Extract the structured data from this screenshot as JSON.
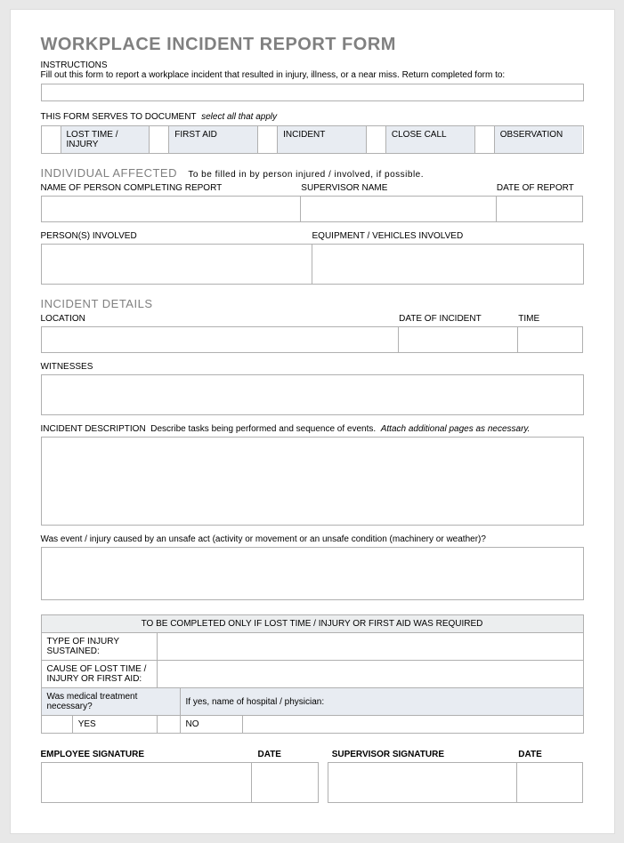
{
  "title": "WORKPLACE INCIDENT REPORT FORM",
  "instructions": {
    "heading": "INSTRUCTIONS",
    "text": "Fill out this form to report a workplace incident that resulted in injury, illness, or a near miss. Return completed form to:"
  },
  "document_purpose": {
    "label": "THIS FORM SERVES TO DOCUMENT",
    "hint": "select all that apply",
    "options": [
      "LOST TIME / INJURY",
      "FIRST AID",
      "INCIDENT",
      "CLOSE CALL",
      "OBSERVATION"
    ]
  },
  "individual": {
    "heading": "INDIVIDUAL AFFECTED",
    "sub": "To be filled in by person injured / involved, if possible.",
    "name_label": "NAME OF PERSON COMPLETING REPORT",
    "supervisor_label": "SUPERVISOR NAME",
    "date_label": "DATE OF REPORT",
    "persons_label": "PERSON(S) INVOLVED",
    "equipment_label": "EQUIPMENT / VEHICLES INVOLVED"
  },
  "details": {
    "heading": "INCIDENT DETAILS",
    "location_label": "LOCATION",
    "date_label": "DATE OF INCIDENT",
    "time_label": "TIME",
    "witnesses_label": "WITNESSES",
    "description_label": "INCIDENT DESCRIPTION",
    "description_hint": "Describe tasks being performed and sequence of events.",
    "description_attach": "Attach additional pages as necessary.",
    "cause_question": "Was event / injury caused by an unsafe act (activity or movement or an unsafe condition (machinery or weather)?"
  },
  "injury": {
    "banner": "TO BE COMPLETED ONLY IF LOST TIME / INJURY OR FIRST AID WAS REQUIRED",
    "type_label": "TYPE OF INJURY SUSTAINED:",
    "cause_label": "CAUSE OF LOST TIME / INJURY OR FIRST AID:",
    "medical_q": "Was medical treatment necessary?",
    "medical_hint": "If yes, name of hospital / physician:",
    "yes": "YES",
    "no": "NO"
  },
  "signatures": {
    "emp_sig": "EMPLOYEE SIGNATURE",
    "date": "DATE",
    "sup_sig": "SUPERVISOR SIGNATURE"
  }
}
